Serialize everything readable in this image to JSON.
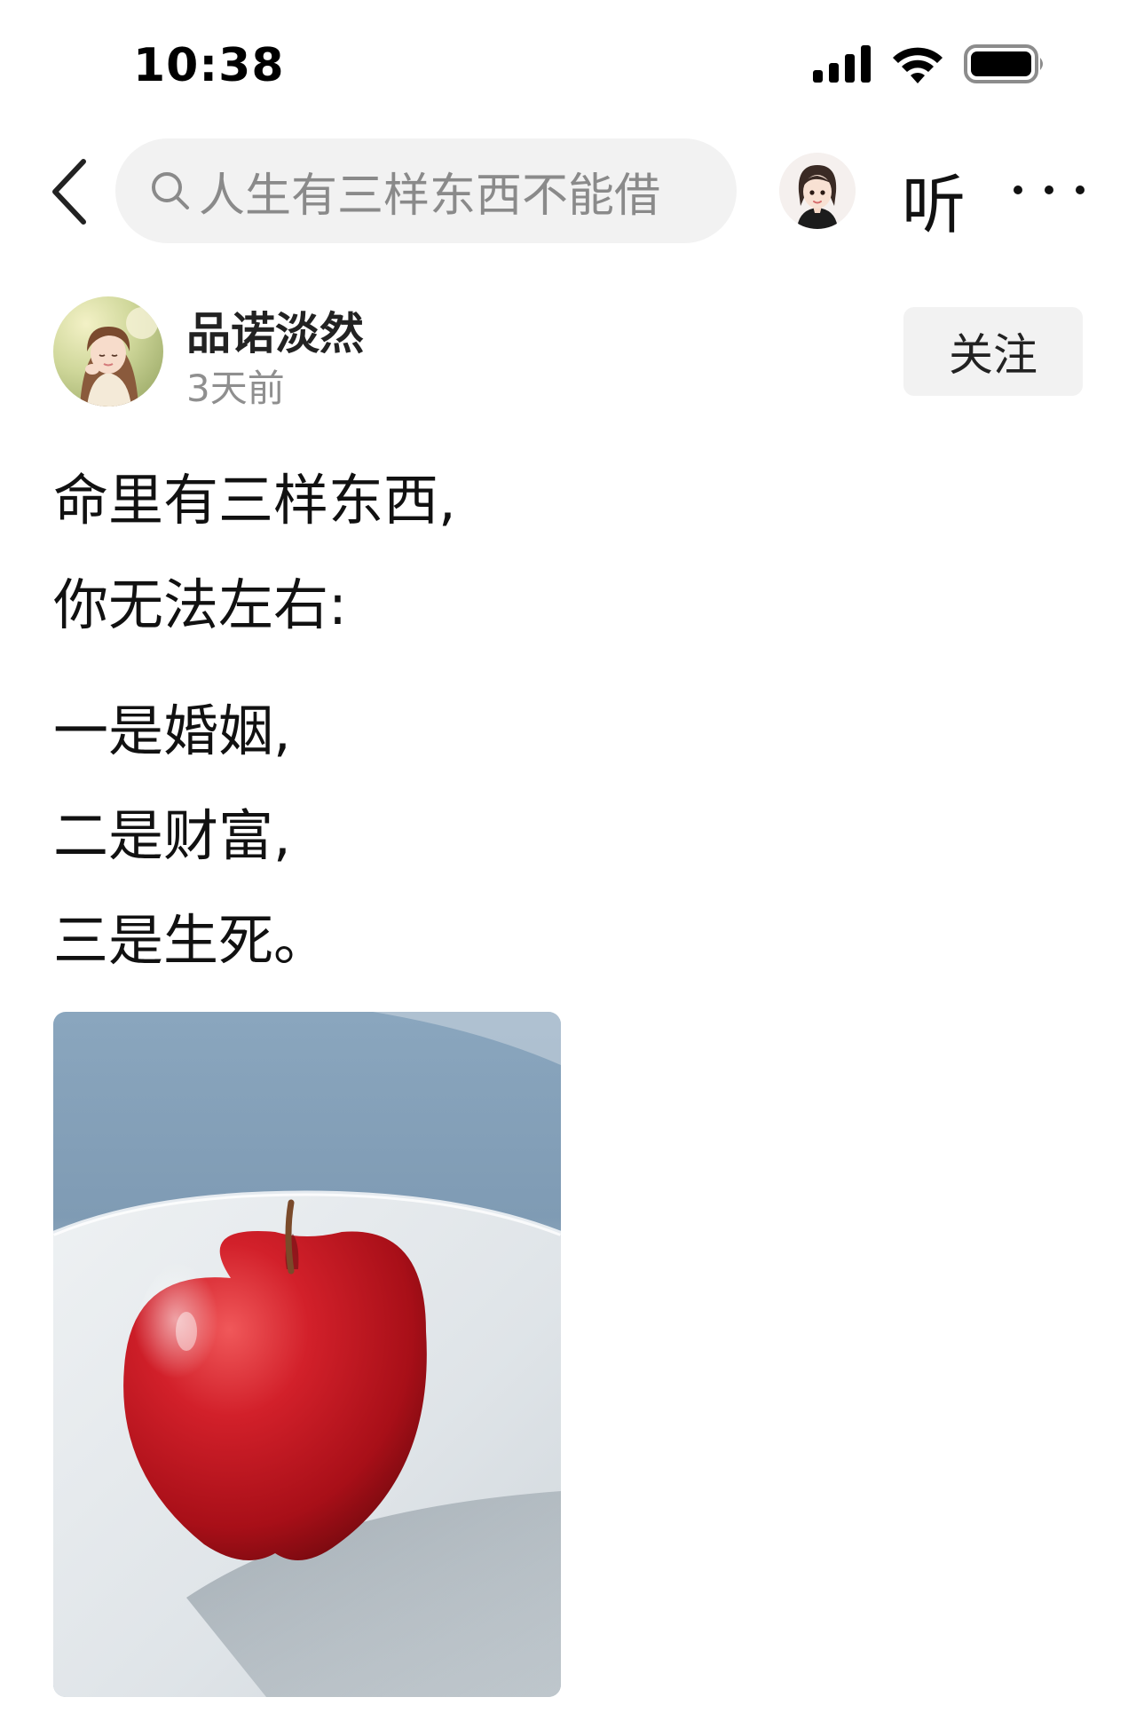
{
  "status_bar": {
    "time": "10:38",
    "icons": [
      "signal-icon",
      "wifi-icon",
      "battery-icon"
    ]
  },
  "nav": {
    "back_icon": "chevron-left-icon",
    "search_placeholder": "人生有三样东西不能借",
    "search_icon": "search-icon",
    "listen_label": "听",
    "more_icon": "more-horizontal-icon"
  },
  "author": {
    "name": "品诺淡然",
    "time": "3天前",
    "follow_label": "关注"
  },
  "post": {
    "lines": [
      "命里有三样东西,",
      "你无法左右:",
      "一是婚姻,",
      "二是财富,",
      "三是生死。"
    ]
  },
  "image": {
    "subject": "red apple on white plate"
  },
  "colors": {
    "background": "#ffffff",
    "search_bg": "#f2f2f2",
    "secondary_text": "#8f8f8f",
    "apple_red": "#c8161f"
  }
}
